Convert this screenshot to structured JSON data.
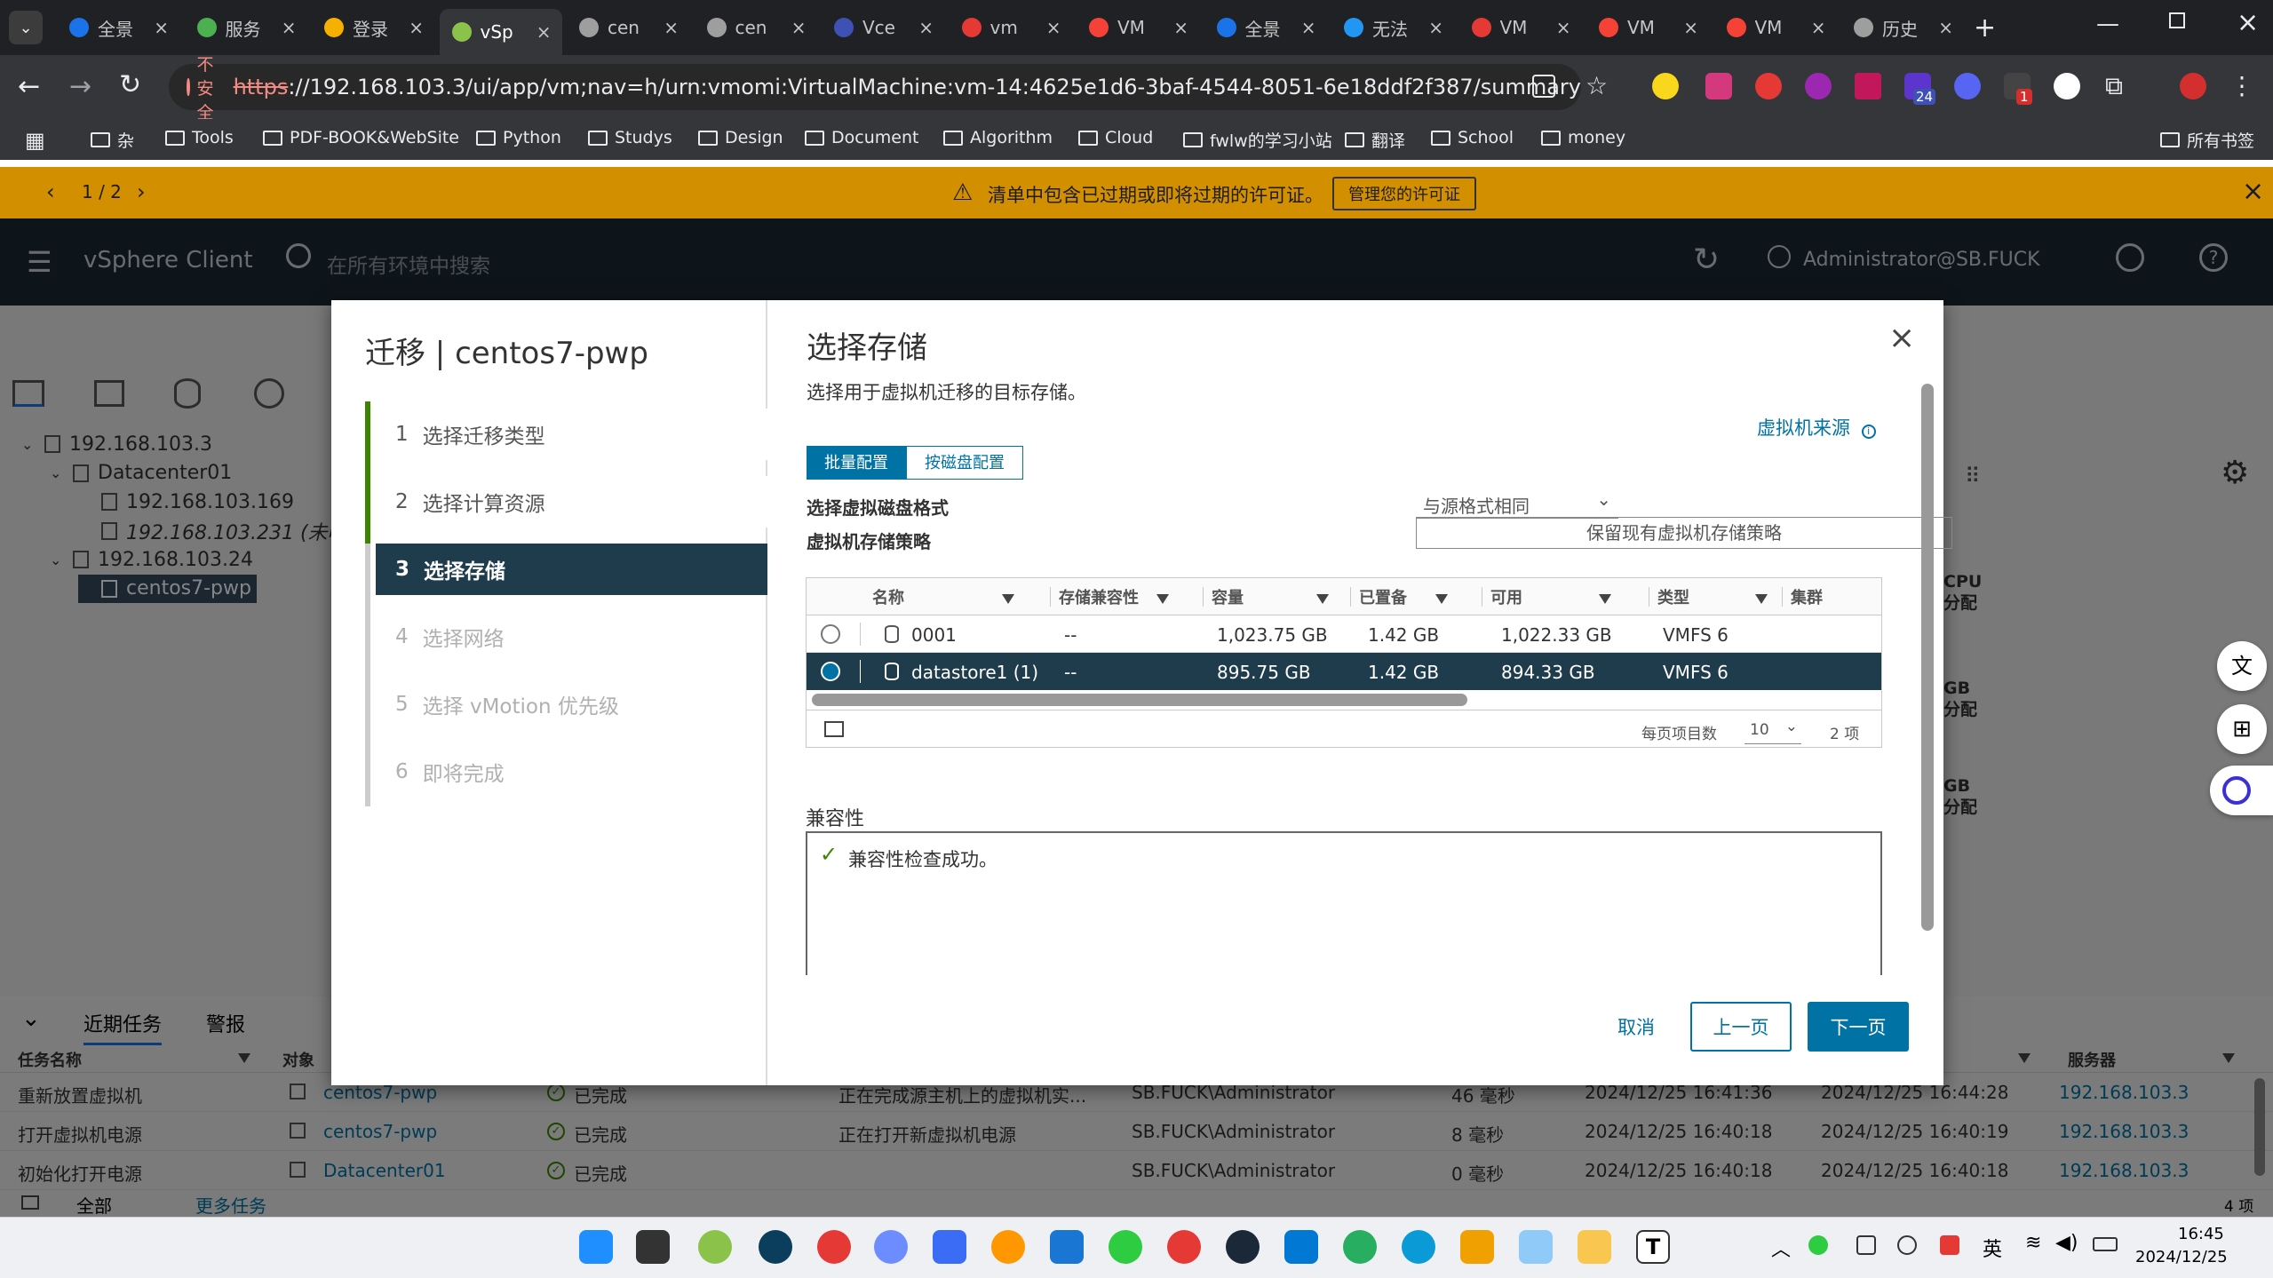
{
  "browser": {
    "tabs": [
      {
        "label": "全景",
        "color": "#1a73e8"
      },
      {
        "label": "服务",
        "color": "#4caf50"
      },
      {
        "label": "登录",
        "color": "#f6b000"
      },
      {
        "label": "vSp",
        "color": "#8bc34a",
        "active": true
      },
      {
        "label": "cen",
        "color": "#9e9e9e"
      },
      {
        "label": "cen",
        "color": "#9e9e9e"
      },
      {
        "label": "Vce",
        "color": "#3f51b5"
      },
      {
        "label": "vm",
        "color": "#e53935"
      },
      {
        "label": "VM",
        "color": "#f44336"
      },
      {
        "label": "全景",
        "color": "#1a73e8"
      },
      {
        "label": "无法",
        "color": "#2196f3"
      },
      {
        "label": "VM",
        "color": "#e53935"
      },
      {
        "label": "VM",
        "color": "#f44336"
      },
      {
        "label": "VM",
        "color": "#f44336"
      },
      {
        "label": "历史",
        "color": "#9e9e9e"
      }
    ],
    "insecure_label": "不安全",
    "url_scheme": "https",
    "url_rest": "://192.168.103.3/ui/app/vm;nav=h/urn:vmomi:VirtualMachine:vm-14:4625e1d6-3baf-4544-8051-6e18ddf2f387/summary",
    "bookmarks": [
      "杂",
      "Tools",
      "PDF-BOOK&WebSite",
      "Python",
      "Studys",
      "Design",
      "Document",
      "Algorithm",
      "Cloud",
      "fwlw的学习小站",
      "翻译",
      "School",
      "money"
    ],
    "all_bookmarks": "所有书签",
    "ext_badges": {
      "b1": "24",
      "b2": "1"
    }
  },
  "banner": {
    "pager": "1 / 2",
    "message": "清单中包含已过期或即将过期的许可证。",
    "action": "管理您的许可证"
  },
  "vsphere": {
    "product": "vSphere Client",
    "search_placeholder": "在所有环境中搜索",
    "user": "Administrator@SB.FUCK"
  },
  "tree": [
    {
      "label": "192.168.103.3",
      "level": 0
    },
    {
      "label": "Datacenter01",
      "level": 1
    },
    {
      "label": "192.168.103.169",
      "level": 2
    },
    {
      "label": "192.168.103.231 (未响",
      "level": 2,
      "italic": true
    },
    {
      "label": "192.168.103.24",
      "level": 1
    },
    {
      "label": "centos7-pwp",
      "level": 2,
      "selected": true
    }
  ],
  "side_labels": [
    "CPU",
    "分配",
    "GB",
    "分配",
    "GB",
    "分配"
  ],
  "modal": {
    "title": "迁移 | centos7-pwp",
    "steps": [
      {
        "num": "1",
        "label": "选择迁移类型",
        "state": "done"
      },
      {
        "num": "2",
        "label": "选择计算资源",
        "state": "done"
      },
      {
        "num": "3",
        "label": "选择存储",
        "state": "current"
      },
      {
        "num": "4",
        "label": "选择网络",
        "state": "disabled"
      },
      {
        "num": "5",
        "label": "选择 vMotion 优先级",
        "state": "disabled"
      },
      {
        "num": "6",
        "label": "即将完成",
        "state": "disabled"
      }
    ],
    "heading": "选择存储",
    "description": "选择用于虚拟机迁移的目标存储。",
    "vm_origin_link": "虚拟机来源",
    "tab_batch": "批量配置",
    "tab_per_disk": "按磁盘配置",
    "disk_format_label": "选择虚拟磁盘格式",
    "disk_format_value": "与源格式相同",
    "policy_label": "虚拟机存储策略",
    "policy_value": "保留现有虚拟机存储策略",
    "table": {
      "columns": [
        "名称",
        "存储兼容性",
        "容量",
        "已置备",
        "可用",
        "类型",
        "集群"
      ],
      "rows": [
        {
          "name": "0001",
          "compat": "--",
          "capacity": "1,023.75 GB",
          "provisioned": "1.42 GB",
          "free": "1,022.33 GB",
          "type": "VMFS 6",
          "selected": false
        },
        {
          "name": "datastore1 (1)",
          "compat": "--",
          "capacity": "895.75 GB",
          "provisioned": "1.42 GB",
          "free": "894.33 GB",
          "type": "VMFS 6",
          "selected": true
        }
      ],
      "page_size_label": "每页项目数",
      "page_size": "10",
      "count": "2 项"
    },
    "compat_title": "兼容性",
    "compat_message": "兼容性检查成功。",
    "cancel": "取消",
    "back": "上一页",
    "next": "下一页"
  },
  "tasks": {
    "tab_recent": "近期任务",
    "tab_alarms": "警报",
    "headers": {
      "name": "任务名称",
      "object": "对象",
      "server": "服务器"
    },
    "rows": [
      {
        "name": "重新放置虚拟机",
        "object": "centos7-pwp",
        "status": "已完成",
        "detail": "正在完成源主机上的虚拟机实...",
        "initiator": "SB.FUCK\\Administrator",
        "queued": "46 毫秒",
        "start": "2024/12/25 16:41:36",
        "end": "2024/12/25 16:44:28",
        "server": "192.168.103.3"
      },
      {
        "name": "打开虚拟机电源",
        "object": "centos7-pwp",
        "status": "已完成",
        "detail": "正在打开新虚拟机电源",
        "initiator": "SB.FUCK\\Administrator",
        "queued": "8 毫秒",
        "start": "2024/12/25 16:40:18",
        "end": "2024/12/25 16:40:19",
        "server": "192.168.103.3"
      },
      {
        "name": "初始化打开电源",
        "object": "Datacenter01",
        "status": "已完成",
        "detail": "",
        "initiator": "SB.FUCK\\Administrator",
        "queued": "0 毫秒",
        "start": "2024/12/25 16:40:18",
        "end": "2024/12/25 16:40:18",
        "server": "192.168.103.3"
      }
    ],
    "filter_all": "全部",
    "more_tasks": "更多任务",
    "items_count": "4 项"
  },
  "system_tray": {
    "ime": "英",
    "time": "16:45",
    "date": "2024/12/25"
  }
}
